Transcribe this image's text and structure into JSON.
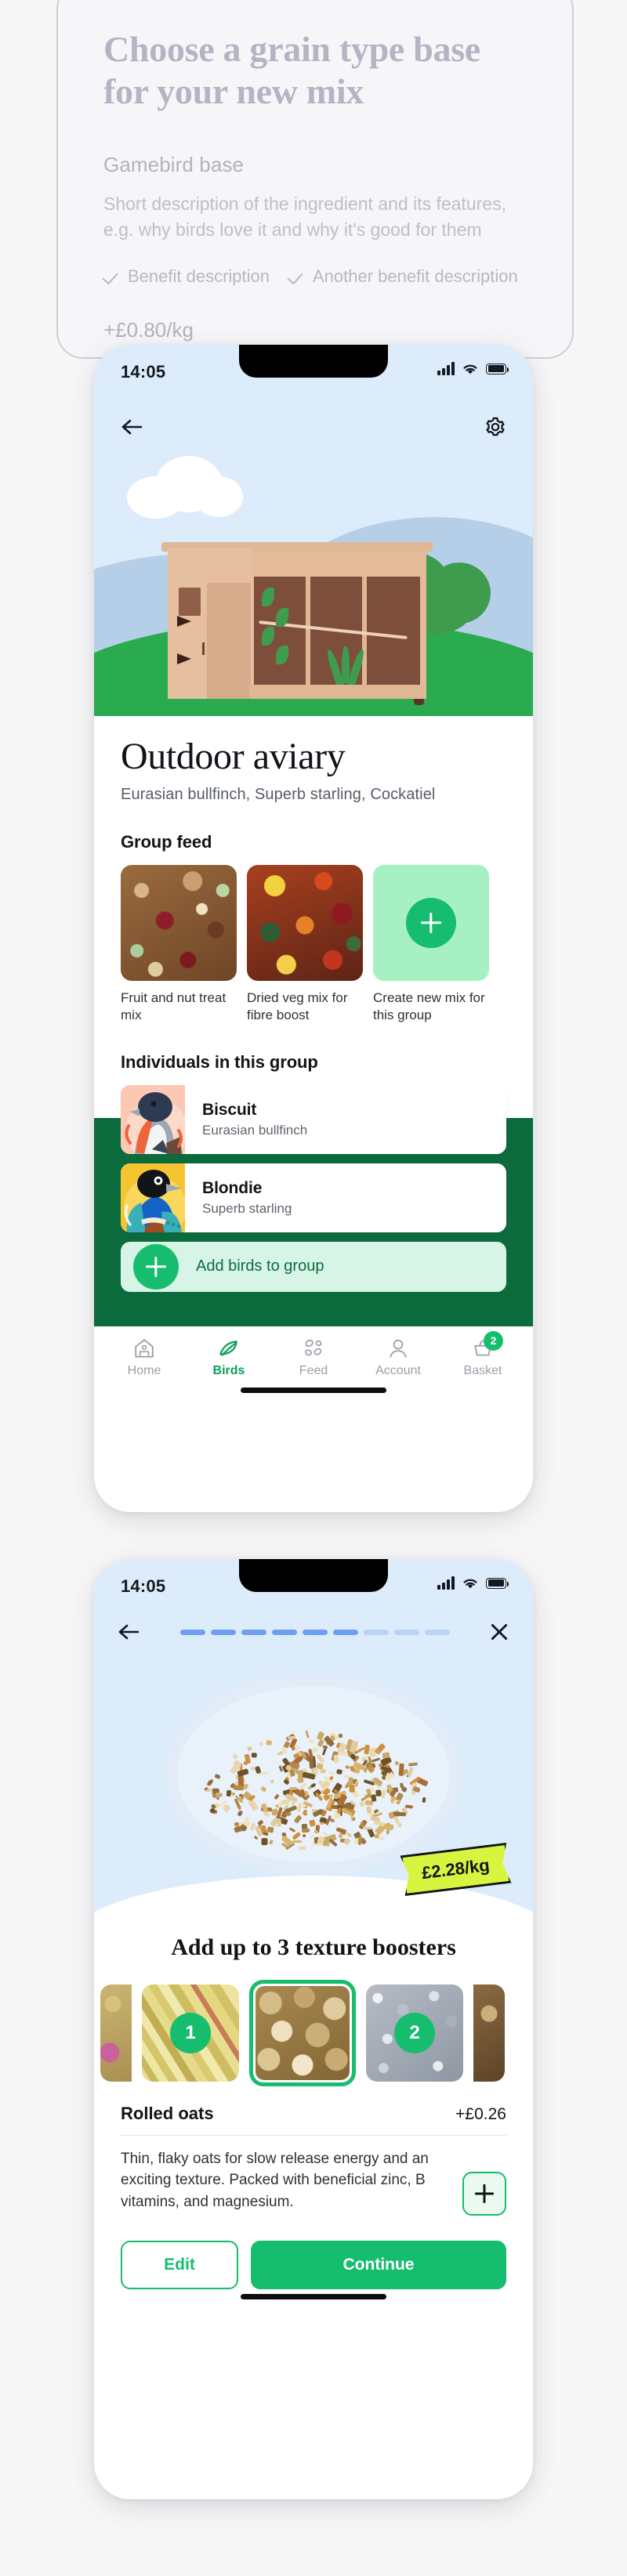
{
  "ghost_card": {
    "title": "Choose a grain type base for your new mix",
    "ingredient_name": "Gamebird base",
    "description": "Short description of the ingredient and its features, e.g. why birds love it and why it's good for them",
    "benefit_one": "Benefit description",
    "benefit_two": "Another benefit description",
    "price": "+£0.80/kg"
  },
  "phone_one": {
    "status": {
      "time": "14:05",
      "signal_icon": "signal-bars-icon",
      "wifi_icon": "wifi-icon",
      "battery_icon": "battery-icon"
    },
    "header": {
      "back_icon": "back-arrow-icon",
      "settings_icon": "gear-icon"
    },
    "title": "Outdoor aviary",
    "subtitle": "Eurasian bullfinch, Superb starling, Cockatiel",
    "group_feed": {
      "heading": "Group feed",
      "items": [
        {
          "label": "Fruit and nut treat mix",
          "type": "photo"
        },
        {
          "label": "Dried veg mix for fibre boost",
          "type": "photo"
        },
        {
          "label": "Create new mix for this group",
          "type": "create",
          "icon": "plus-icon"
        }
      ]
    },
    "individuals": {
      "heading": "Individuals in this group",
      "birds": [
        {
          "name": "Biscuit",
          "species": "Eurasian bullfinch"
        },
        {
          "name": "Blondie",
          "species": "Superb starling"
        }
      ],
      "add_label": "Add birds to group",
      "add_icon": "plus-icon"
    },
    "tabs": [
      {
        "label": "Home",
        "icon": "home-icon",
        "active": false
      },
      {
        "label": "Birds",
        "icon": "feather-icon",
        "active": true
      },
      {
        "label": "Feed",
        "icon": "seeds-icon",
        "active": false
      },
      {
        "label": "Account",
        "icon": "person-icon",
        "active": false
      },
      {
        "label": "Basket",
        "icon": "basket-icon",
        "active": false,
        "badge": "2"
      }
    ]
  },
  "phone_two": {
    "status": {
      "time": "14:05",
      "signal_icon": "signal-bars-icon",
      "wifi_icon": "wifi-icon",
      "battery_icon": "battery-icon"
    },
    "header": {
      "back_icon": "back-arrow-icon",
      "close_icon": "close-x-icon"
    },
    "progress": {
      "total": 9,
      "filled": 6
    },
    "price_tag": "£2.28/kg",
    "booster_heading": "Add up to 3 texture boosters",
    "boosters": [
      {
        "name": "edge-left",
        "badge": "",
        "selected": false
      },
      {
        "name": "dried-herbs",
        "badge": "1",
        "selected": false
      },
      {
        "name": "rolled-oats",
        "badge": "",
        "selected": true
      },
      {
        "name": "grit",
        "badge": "2",
        "selected": false
      },
      {
        "name": "edge-right",
        "badge": "",
        "selected": false
      }
    ],
    "detail": {
      "name": "Rolled oats",
      "price": "+£0.26",
      "description": "Thin, flaky oats for slow release energy and an exciting texture. Packed with beneficial zinc, B vitamins, and magnesium.",
      "add_icon": "plus-icon"
    },
    "cta": {
      "edit_label": "Edit",
      "continue_label": "Continue"
    }
  },
  "colors": {
    "brand_green": "#16bd6e",
    "dark_green": "#0c6b3d",
    "sky_blue": "#ddecfa",
    "tag_yellow": "#d7f53f",
    "progress_active": "#6e9fee",
    "progress_inactive": "#b9d2f5"
  }
}
